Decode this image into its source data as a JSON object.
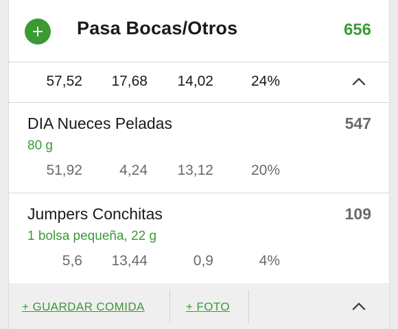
{
  "meal": {
    "title": "Pasa Bocas/Otros",
    "total_calories": "656",
    "add_icon": "plus-icon",
    "summary": {
      "carbs": "57,52",
      "fat": "17,68",
      "protein": "14,02",
      "percent": "24%"
    }
  },
  "foods": [
    {
      "name": "DIA Nueces Peladas",
      "quantity": "80 g",
      "calories": "547",
      "carbs": "51,92",
      "fat": "4,24",
      "protein": "13,12",
      "percent": "20%"
    },
    {
      "name": "Jumpers Conchitas",
      "quantity": "1 bolsa pequeña, 22 g",
      "calories": "109",
      "carbs": "5,6",
      "fat": "13,44",
      "protein": "0,9",
      "percent": "4%"
    }
  ],
  "footer": {
    "save_meal": "+ GUARDAR COMIDA",
    "photo": "+ FOTO"
  },
  "colors": {
    "accent_green": "#3a9a34",
    "text_dark": "#1a1a1a",
    "text_muted": "#6a6a6a"
  }
}
